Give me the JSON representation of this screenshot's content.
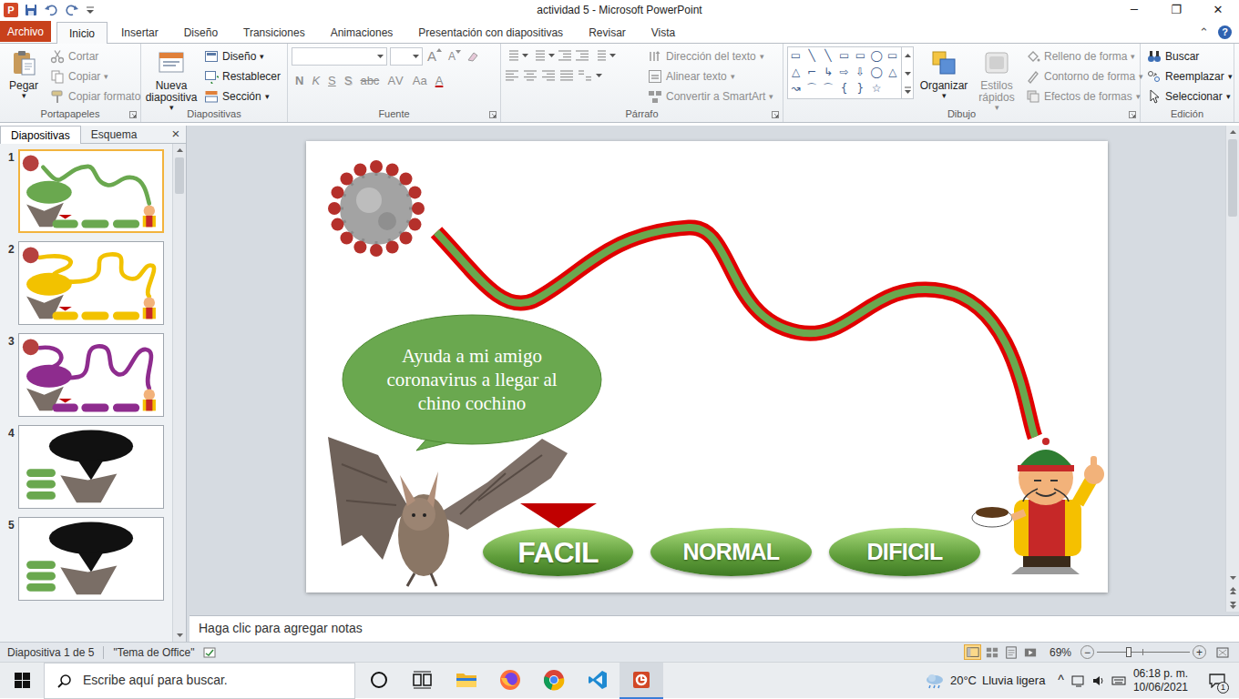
{
  "window": {
    "app_icon": "P",
    "title": "actividad 5 - Microsoft PowerPoint",
    "controls": [
      "─",
      "❐",
      "✕"
    ]
  },
  "ribbon": {
    "file_tab": "Archivo",
    "tabs": [
      {
        "label": "Inicio",
        "selected": true
      },
      {
        "label": "Insertar",
        "selected": false
      },
      {
        "label": "Diseño",
        "selected": false
      },
      {
        "label": "Transiciones",
        "selected": false
      },
      {
        "label": "Animaciones",
        "selected": false
      },
      {
        "label": "Presentación con diapositivas",
        "selected": false
      },
      {
        "label": "Revisar",
        "selected": false
      },
      {
        "label": "Vista",
        "selected": false
      }
    ],
    "collapse": "⌃",
    "help": "?",
    "clipboard": {
      "label": "Portapapeles",
      "paste": {
        "label": "Pegar",
        "arrow": "▾"
      },
      "items": [
        {
          "label": "Cortar",
          "disabled": true
        },
        {
          "label": "Copiar",
          "arrow": "▾",
          "disabled": true
        },
        {
          "label": "Copiar formato",
          "disabled": true
        }
      ]
    },
    "slides": {
      "label": "Diapositivas",
      "new_slide": {
        "label": "Nueva diapositiva",
        "arrow": "▾"
      },
      "items": [
        {
          "label": "Diseño",
          "arrow": "▾",
          "disabled": false
        },
        {
          "label": "Restablecer",
          "disabled": false
        },
        {
          "label": "Sección",
          "arrow": "▾",
          "disabled": false
        }
      ]
    },
    "font": {
      "label": "Fuente",
      "disabled": true,
      "size_buttons": [
        "A",
        "A"
      ],
      "format_buttons": [
        "N",
        "K",
        "S",
        "S",
        "abc",
        "AV",
        "Aa",
        "A"
      ]
    },
    "paragraph": {
      "label": "Párrafo",
      "items": [
        {
          "label": "Dirección del texto",
          "arrow": "▾",
          "disabled": true
        },
        {
          "label": "Alinear texto",
          "arrow": "▾",
          "disabled": true
        },
        {
          "label": "Convertir a SmartArt",
          "arrow": "▾",
          "disabled": true
        }
      ]
    },
    "drawing": {
      "label": "Dibujo",
      "shapes": [
        "▭",
        "╲",
        "╲",
        "▭",
        "▭",
        "◯",
        "▭",
        "△",
        "⌐",
        "↳",
        "⇨",
        "⇩",
        "◯",
        "△",
        "↝",
        "⌒",
        "⌒",
        "{",
        "}",
        "☆"
      ],
      "arrange": {
        "label": "Organizar",
        "arrow": "▾",
        "disabled": false
      },
      "quick_styles": {
        "label": "Estilos rápidos",
        "arrow": "▾",
        "disabled": true
      },
      "items": [
        {
          "label": "Relleno de forma",
          "arrow": "▾",
          "disabled": true
        },
        {
          "label": "Contorno de forma",
          "arrow": "▾",
          "disabled": true
        },
        {
          "label": "Efectos de formas",
          "arrow": "▾",
          "disabled": true
        }
      ]
    },
    "editing": {
      "label": "Edición",
      "items": [
        {
          "label": "Buscar",
          "disabled": false
        },
        {
          "label": "Reemplazar",
          "arrow": "▾",
          "disabled": false
        },
        {
          "label": "Seleccionar",
          "arrow": "▾",
          "disabled": false
        }
      ]
    }
  },
  "slide_panel": {
    "tabs": [
      {
        "label": "Diapositivas",
        "selected": true
      },
      {
        "label": "Esquema",
        "selected": false
      }
    ],
    "close": "×",
    "slides": [
      {
        "number": "1",
        "selected": true,
        "kind": "maze",
        "color": "#6aa84f"
      },
      {
        "number": "2",
        "selected": false,
        "kind": "maze",
        "color": "#f2c200"
      },
      {
        "number": "3",
        "selected": false,
        "kind": "maze",
        "color": "#8e2c8e"
      },
      {
        "number": "4",
        "selected": false,
        "kind": "message",
        "color": "#6aa84f"
      },
      {
        "number": "5",
        "selected": false,
        "kind": "message",
        "color": "#6aa84f"
      }
    ]
  },
  "slide": {
    "bubble": "Ayuda a mi amigo coronavirus a llegar al chino cochino",
    "levels": [
      {
        "label": "FACIL",
        "selected": true
      },
      {
        "label": "NORMAL",
        "selected": false
      },
      {
        "label": "DIFICIL",
        "selected": false
      }
    ]
  },
  "notes": {
    "placeholder": "Haga clic para agregar notas"
  },
  "status_bar": {
    "slide": "Diapositiva 1 de 5",
    "theme": "\"Tema de Office\"",
    "views": [
      {
        "selected": true
      },
      {
        "selected": false
      },
      {
        "selected": false
      },
      {
        "selected": false
      }
    ],
    "zoom": "69%",
    "zoom_out": "−",
    "zoom_in": "+",
    "zoom_level": 0.34
  },
  "taskbar": {
    "search": {
      "placeholder": "Escribe aquí para buscar."
    },
    "apps": [
      {
        "selected": false
      },
      {
        "selected": false
      },
      {
        "selected": false
      },
      {
        "selected": false
      },
      {
        "selected": false
      },
      {
        "selected": false
      },
      {
        "selected": true
      }
    ],
    "temperature": "20°C",
    "weather": "Lluvia ligera",
    "tray_arrow": "^",
    "time": "06:18 p. m.",
    "date": "10/06/2021",
    "notifications": "1"
  }
}
